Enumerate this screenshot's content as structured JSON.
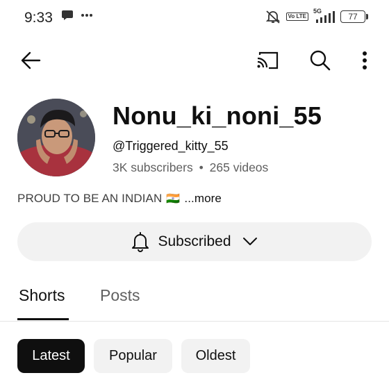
{
  "status_bar": {
    "time": "9:33",
    "network": "5G",
    "volte": "Vo LTE",
    "battery": "77"
  },
  "toolbar": {
    "back_icon": "arrow-left-icon",
    "cast_icon": "cast-icon",
    "search_icon": "search-icon",
    "menu_icon": "more-vertical-icon"
  },
  "channel": {
    "name": "Nonu_ki_noni_55",
    "handle": "@Triggered_kitty_55",
    "subscribers": "3K subscribers",
    "separator": "•",
    "videos": "265 videos",
    "description": "PROUD TO BE AN INDIAN",
    "flag": "🇮🇳",
    "more_label": "...more"
  },
  "subscribe": {
    "label": "Subscribed",
    "bell_icon": "bell-icon",
    "chevron_icon": "chevron-down-icon"
  },
  "tabs": [
    {
      "label": "Shorts",
      "active": true
    },
    {
      "label": "Posts",
      "active": false
    }
  ],
  "filters": [
    {
      "label": "Latest",
      "active": true
    },
    {
      "label": "Popular",
      "active": false
    },
    {
      "label": "Oldest",
      "active": false
    }
  ]
}
